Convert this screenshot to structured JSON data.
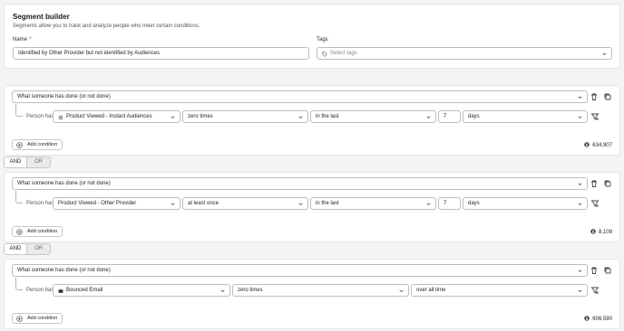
{
  "header": {
    "title": "Segment builder",
    "subtitle": "Segments allow you to track and analyze people who meet certain conditions.",
    "name_label": "Name",
    "required_mark": "*",
    "name_value": "Identified by Other Provider but not identified by Audiences",
    "tags_label": "Tags",
    "tags_placeholder": "Select tags"
  },
  "groups": [
    {
      "condition_type": "What someone has done (or not done)",
      "person_has_label": "Person has",
      "event": "Product Viewed - Instant Audiences",
      "event_icon": "gear-icon",
      "frequency": "zero times",
      "timeframe": "in the last",
      "amount": "7",
      "unit": "days",
      "add_condition": "Add condition",
      "count": "634,907"
    },
    {
      "condition_type": "What someone has done (or not done)",
      "person_has_label": "Person has",
      "event": "Product Viewed - Other Provider",
      "frequency": "at least once",
      "timeframe": "in the last",
      "amount": "7",
      "unit": "days",
      "add_condition": "Add condition",
      "count": "8,109"
    },
    {
      "condition_type": "What someone has done (or not done)",
      "person_has_label": "Person has",
      "event": "Bounced Email",
      "event_icon": "flag-icon",
      "frequency": "zero times",
      "timeframe": "over all time",
      "add_condition": "Add condition",
      "count": "606,590"
    }
  ],
  "operators": [
    {
      "and_label": "AND",
      "or_label": "OR",
      "selected": "AND"
    },
    {
      "and_label": "AND",
      "or_label": "OR",
      "selected": "AND"
    }
  ],
  "icons": {
    "delete": "trash-icon",
    "duplicate": "copy-icon",
    "clear_filter": "filter-clear-icon",
    "people": "person-icon",
    "dropdown": "chevron-down-icon",
    "tag": "tag-icon",
    "add": "plus-circle-icon"
  }
}
